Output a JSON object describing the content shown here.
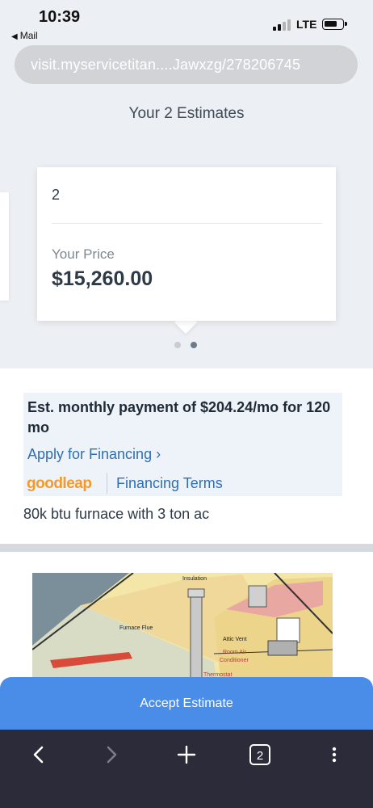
{
  "status_bar": {
    "time": "10:39",
    "back_app": "Mail",
    "network": "LTE"
  },
  "browser": {
    "url": "visit.myservicetitan....Jawxzg/278206745",
    "tab_count": "2"
  },
  "estimates": {
    "title": "Your 2 Estimates",
    "card": {
      "number": "2",
      "price_label": "Your Price",
      "price_value": "$15,260.00"
    },
    "pagination": {
      "total": 2,
      "active": 2
    }
  },
  "financing": {
    "monthly_text": "Est. monthly payment of $204.24/mo for 120 mo",
    "apply_link": "Apply for Financing ›",
    "provider_logo": "goodleap",
    "terms_link": "Financing Terms"
  },
  "description": "80k btu furnace with 3 ton ac",
  "diagram": {
    "labels": [
      "Insulation",
      "Furnace Flue",
      "Attic Vent",
      "Room Air",
      "Conditioner",
      "Thermostat"
    ]
  },
  "actions": {
    "accept_label": "Accept Estimate"
  },
  "colors": {
    "accent_blue": "#4a8de8",
    "link_blue": "#2f6fb2",
    "goodleap_orange": "#f39a2b",
    "toolbar_bg": "#2b2b3a"
  }
}
